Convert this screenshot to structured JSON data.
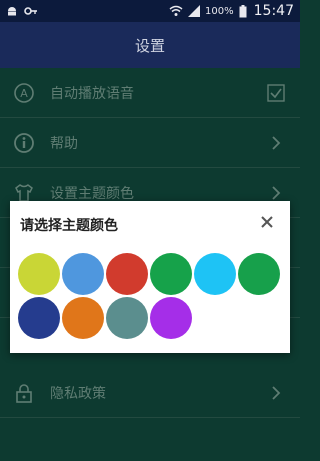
{
  "status_bar": {
    "time": "15:47",
    "battery": "100%"
  },
  "header": {
    "title": "设置"
  },
  "settings": {
    "items": [
      {
        "label": "自动播放语音",
        "icon": "autoplay-a-icon",
        "control": "checkbox-checked"
      },
      {
        "label": "帮助",
        "icon": "info-icon",
        "control": "chevron-right"
      },
      {
        "label": "设置主题颜色",
        "icon": "shirt-icon",
        "control": "chevron-right"
      },
      {
        "label": "",
        "icon": "",
        "control": ""
      },
      {
        "label": "",
        "icon": "",
        "control": ""
      },
      {
        "label": "隐私政策",
        "icon": "lock-icon",
        "control": "chevron-right"
      }
    ]
  },
  "dialog": {
    "title": "请选择主题颜色",
    "close_icon": "close-icon",
    "colors": [
      "#c9d636",
      "#4f97de",
      "#d13b2d",
      "#16a24a",
      "#1ec3f5",
      "#17a04b",
      "#253c8e",
      "#e0761a",
      "#5b8e8e",
      "#a52ee8"
    ]
  }
}
